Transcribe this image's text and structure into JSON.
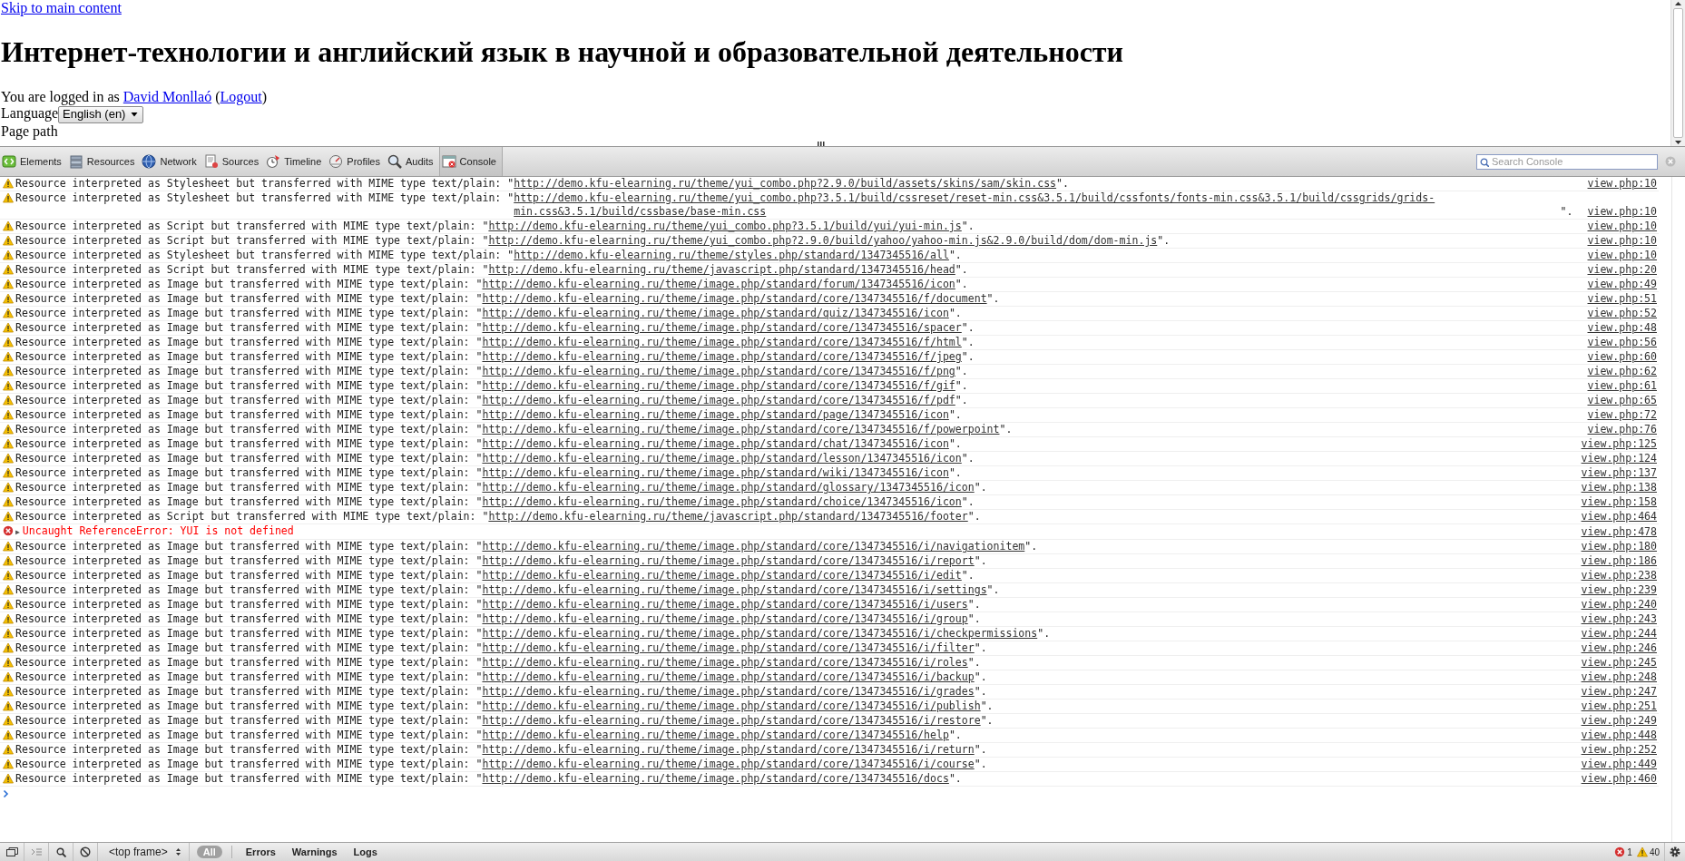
{
  "page": {
    "skip_link": "Skip to main content",
    "heading": "Интернет-технологии и английский язык в научной и образовательной деятельности",
    "login": {
      "prefix": "You are logged in as ",
      "user": "David Monllaó",
      "open": " (",
      "logout": "Logout",
      "close": ")"
    },
    "language": {
      "label": "Language",
      "value": "English (en)"
    },
    "breadcrumb_label": "Page path"
  },
  "devtools": {
    "tabs": [
      {
        "label": "Elements",
        "selected": false
      },
      {
        "label": "Resources",
        "selected": false
      },
      {
        "label": "Network",
        "selected": false
      },
      {
        "label": "Sources",
        "selected": false
      },
      {
        "label": "Timeline",
        "selected": false
      },
      {
        "label": "Profiles",
        "selected": false
      },
      {
        "label": "Audits",
        "selected": false
      },
      {
        "label": "Console",
        "selected": true
      }
    ],
    "search": {
      "placeholder": "Search Console"
    }
  },
  "console": {
    "messages": [
      {
        "kind": "warning",
        "prefix": "Resource interpreted as Stylesheet but transferred with MIME type text/plain: \"",
        "url": "http://demo.kfu-elearning.ru/theme/yui_combo.php?2.9.0/build/assets/skins/sam/skin.css",
        "suffix": "\".",
        "source": "view.php:10"
      },
      {
        "kind": "warning",
        "prefix": "Resource interpreted as Stylesheet but transferred with MIME type text/plain: \"",
        "url": "http://demo.kfu-elearning.ru/theme/yui_combo.php?3.5.1/build/cssreset/reset-min.css&3.5.1/build/cssfonts/fonts-min.css&3.5.1/build/cssgrids/grids-min.css&3.5.1/build/cssbase/base-min.css",
        "suffix": "\".",
        "source": "view.php:10"
      },
      {
        "kind": "warning",
        "prefix": "Resource interpreted as Script but transferred with MIME type text/plain: \"",
        "url": "http://demo.kfu-elearning.ru/theme/yui_combo.php?3.5.1/build/yui/yui-min.js",
        "suffix": "\".",
        "source": "view.php:10"
      },
      {
        "kind": "warning",
        "prefix": "Resource interpreted as Script but transferred with MIME type text/plain: \"",
        "url": "http://demo.kfu-elearning.ru/theme/yui_combo.php?2.9.0/build/yahoo/yahoo-min.js&2.9.0/build/dom/dom-min.js",
        "suffix": "\".",
        "source": "view.php:10"
      },
      {
        "kind": "warning",
        "prefix": "Resource interpreted as Stylesheet but transferred with MIME type text/plain: \"",
        "url": "http://demo.kfu-elearning.ru/theme/styles.php/standard/1347345516/all",
        "suffix": "\".",
        "source": "view.php:10"
      },
      {
        "kind": "warning",
        "prefix": "Resource interpreted as Script but transferred with MIME type text/plain: \"",
        "url": "http://demo.kfu-elearning.ru/theme/javascript.php/standard/1347345516/head",
        "suffix": "\".",
        "source": "view.php:20"
      },
      {
        "kind": "warning",
        "prefix": "Resource interpreted as Image but transferred with MIME type text/plain: \"",
        "url": "http://demo.kfu-elearning.ru/theme/image.php/standard/forum/1347345516/icon",
        "suffix": "\".",
        "source": "view.php:49"
      },
      {
        "kind": "warning",
        "prefix": "Resource interpreted as Image but transferred with MIME type text/plain: \"",
        "url": "http://demo.kfu-elearning.ru/theme/image.php/standard/core/1347345516/f/document",
        "suffix": "\".",
        "source": "view.php:51"
      },
      {
        "kind": "warning",
        "prefix": "Resource interpreted as Image but transferred with MIME type text/plain: \"",
        "url": "http://demo.kfu-elearning.ru/theme/image.php/standard/quiz/1347345516/icon",
        "suffix": "\".",
        "source": "view.php:52"
      },
      {
        "kind": "warning",
        "prefix": "Resource interpreted as Image but transferred with MIME type text/plain: \"",
        "url": "http://demo.kfu-elearning.ru/theme/image.php/standard/core/1347345516/spacer",
        "suffix": "\".",
        "source": "view.php:48"
      },
      {
        "kind": "warning",
        "prefix": "Resource interpreted as Image but transferred with MIME type text/plain: \"",
        "url": "http://demo.kfu-elearning.ru/theme/image.php/standard/core/1347345516/f/html",
        "suffix": "\".",
        "source": "view.php:56"
      },
      {
        "kind": "warning",
        "prefix": "Resource interpreted as Image but transferred with MIME type text/plain: \"",
        "url": "http://demo.kfu-elearning.ru/theme/image.php/standard/core/1347345516/f/jpeg",
        "suffix": "\".",
        "source": "view.php:60"
      },
      {
        "kind": "warning",
        "prefix": "Resource interpreted as Image but transferred with MIME type text/plain: \"",
        "url": "http://demo.kfu-elearning.ru/theme/image.php/standard/core/1347345516/f/png",
        "suffix": "\".",
        "source": "view.php:62"
      },
      {
        "kind": "warning",
        "prefix": "Resource interpreted as Image but transferred with MIME type text/plain: \"",
        "url": "http://demo.kfu-elearning.ru/theme/image.php/standard/core/1347345516/f/gif",
        "suffix": "\".",
        "source": "view.php:61"
      },
      {
        "kind": "warning",
        "prefix": "Resource interpreted as Image but transferred with MIME type text/plain: \"",
        "url": "http://demo.kfu-elearning.ru/theme/image.php/standard/core/1347345516/f/pdf",
        "suffix": "\".",
        "source": "view.php:65"
      },
      {
        "kind": "warning",
        "prefix": "Resource interpreted as Image but transferred with MIME type text/plain: \"",
        "url": "http://demo.kfu-elearning.ru/theme/image.php/standard/page/1347345516/icon",
        "suffix": "\".",
        "source": "view.php:72"
      },
      {
        "kind": "warning",
        "prefix": "Resource interpreted as Image but transferred with MIME type text/plain: \"",
        "url": "http://demo.kfu-elearning.ru/theme/image.php/standard/core/1347345516/f/powerpoint",
        "suffix": "\".",
        "source": "view.php:76"
      },
      {
        "kind": "warning",
        "prefix": "Resource interpreted as Image but transferred with MIME type text/plain: \"",
        "url": "http://demo.kfu-elearning.ru/theme/image.php/standard/chat/1347345516/icon",
        "suffix": "\".",
        "source": "view.php:125"
      },
      {
        "kind": "warning",
        "prefix": "Resource interpreted as Image but transferred with MIME type text/plain: \"",
        "url": "http://demo.kfu-elearning.ru/theme/image.php/standard/lesson/1347345516/icon",
        "suffix": "\".",
        "source": "view.php:124"
      },
      {
        "kind": "warning",
        "prefix": "Resource interpreted as Image but transferred with MIME type text/plain: \"",
        "url": "http://demo.kfu-elearning.ru/theme/image.php/standard/wiki/1347345516/icon",
        "suffix": "\".",
        "source": "view.php:137"
      },
      {
        "kind": "warning",
        "prefix": "Resource interpreted as Image but transferred with MIME type text/plain: \"",
        "url": "http://demo.kfu-elearning.ru/theme/image.php/standard/glossary/1347345516/icon",
        "suffix": "\".",
        "source": "view.php:138"
      },
      {
        "kind": "warning",
        "prefix": "Resource interpreted as Image but transferred with MIME type text/plain: \"",
        "url": "http://demo.kfu-elearning.ru/theme/image.php/standard/choice/1347345516/icon",
        "suffix": "\".",
        "source": "view.php:158"
      },
      {
        "kind": "warning",
        "prefix": "Resource interpreted as Script but transferred with MIME type text/plain: \"",
        "url": "http://demo.kfu-elearning.ru/theme/javascript.php/standard/1347345516/footer",
        "suffix": "\".",
        "source": "view.php:464"
      },
      {
        "kind": "error",
        "toggle": "▶",
        "text": "Uncaught ReferenceError: YUI is not defined",
        "source": "view.php:478"
      },
      {
        "kind": "warning",
        "prefix": "Resource interpreted as Image but transferred with MIME type text/plain: \"",
        "url": "http://demo.kfu-elearning.ru/theme/image.php/standard/core/1347345516/i/navigationitem",
        "suffix": "\".",
        "source": "view.php:180"
      },
      {
        "kind": "warning",
        "prefix": "Resource interpreted as Image but transferred with MIME type text/plain: \"",
        "url": "http://demo.kfu-elearning.ru/theme/image.php/standard/core/1347345516/i/report",
        "suffix": "\".",
        "source": "view.php:186"
      },
      {
        "kind": "warning",
        "prefix": "Resource interpreted as Image but transferred with MIME type text/plain: \"",
        "url": "http://demo.kfu-elearning.ru/theme/image.php/standard/core/1347345516/i/edit",
        "suffix": "\".",
        "source": "view.php:238"
      },
      {
        "kind": "warning",
        "prefix": "Resource interpreted as Image but transferred with MIME type text/plain: \"",
        "url": "http://demo.kfu-elearning.ru/theme/image.php/standard/core/1347345516/i/settings",
        "suffix": "\".",
        "source": "view.php:239"
      },
      {
        "kind": "warning",
        "prefix": "Resource interpreted as Image but transferred with MIME type text/plain: \"",
        "url": "http://demo.kfu-elearning.ru/theme/image.php/standard/core/1347345516/i/users",
        "suffix": "\".",
        "source": "view.php:240"
      },
      {
        "kind": "warning",
        "prefix": "Resource interpreted as Image but transferred with MIME type text/plain: \"",
        "url": "http://demo.kfu-elearning.ru/theme/image.php/standard/core/1347345516/i/group",
        "suffix": "\".",
        "source": "view.php:243"
      },
      {
        "kind": "warning",
        "prefix": "Resource interpreted as Image but transferred with MIME type text/plain: \"",
        "url": "http://demo.kfu-elearning.ru/theme/image.php/standard/core/1347345516/i/checkpermissions",
        "suffix": "\".",
        "source": "view.php:244"
      },
      {
        "kind": "warning",
        "prefix": "Resource interpreted as Image but transferred with MIME type text/plain: \"",
        "url": "http://demo.kfu-elearning.ru/theme/image.php/standard/core/1347345516/i/filter",
        "suffix": "\".",
        "source": "view.php:246"
      },
      {
        "kind": "warning",
        "prefix": "Resource interpreted as Image but transferred with MIME type text/plain: \"",
        "url": "http://demo.kfu-elearning.ru/theme/image.php/standard/core/1347345516/i/roles",
        "suffix": "\".",
        "source": "view.php:245"
      },
      {
        "kind": "warning",
        "prefix": "Resource interpreted as Image but transferred with MIME type text/plain: \"",
        "url": "http://demo.kfu-elearning.ru/theme/image.php/standard/core/1347345516/i/backup",
        "suffix": "\".",
        "source": "view.php:248"
      },
      {
        "kind": "warning",
        "prefix": "Resource interpreted as Image but transferred with MIME type text/plain: \"",
        "url": "http://demo.kfu-elearning.ru/theme/image.php/standard/core/1347345516/i/grades",
        "suffix": "\".",
        "source": "view.php:247"
      },
      {
        "kind": "warning",
        "prefix": "Resource interpreted as Image but transferred with MIME type text/plain: \"",
        "url": "http://demo.kfu-elearning.ru/theme/image.php/standard/core/1347345516/i/publish",
        "suffix": "\".",
        "source": "view.php:251"
      },
      {
        "kind": "warning",
        "prefix": "Resource interpreted as Image but transferred with MIME type text/plain: \"",
        "url": "http://demo.kfu-elearning.ru/theme/image.php/standard/core/1347345516/i/restore",
        "suffix": "\".",
        "source": "view.php:249"
      },
      {
        "kind": "warning",
        "prefix": "Resource interpreted as Image but transferred with MIME type text/plain: \"",
        "url": "http://demo.kfu-elearning.ru/theme/image.php/standard/core/1347345516/help",
        "suffix": "\".",
        "source": "view.php:448"
      },
      {
        "kind": "warning",
        "prefix": "Resource interpreted as Image but transferred with MIME type text/plain: \"",
        "url": "http://demo.kfu-elearning.ru/theme/image.php/standard/core/1347345516/i/return",
        "suffix": "\".",
        "source": "view.php:252"
      },
      {
        "kind": "warning",
        "prefix": "Resource interpreted as Image but transferred with MIME type text/plain: \"",
        "url": "http://demo.kfu-elearning.ru/theme/image.php/standard/core/1347345516/i/course",
        "suffix": "\".",
        "source": "view.php:449"
      },
      {
        "kind": "warning",
        "prefix": "Resource interpreted as Image but transferred with MIME type text/plain: \"",
        "url": "http://demo.kfu-elearning.ru/theme/image.php/standard/core/1347345516/docs",
        "suffix": "\".",
        "source": "view.php:460"
      }
    ]
  },
  "status_bar": {
    "frame": "<top frame>",
    "filters": [
      {
        "label": "All",
        "selected": true
      },
      {
        "label": "Errors",
        "selected": false
      },
      {
        "label": "Warnings",
        "selected": false
      },
      {
        "label": "Logs",
        "selected": false
      }
    ],
    "error_count": "1",
    "warning_count": "40"
  }
}
